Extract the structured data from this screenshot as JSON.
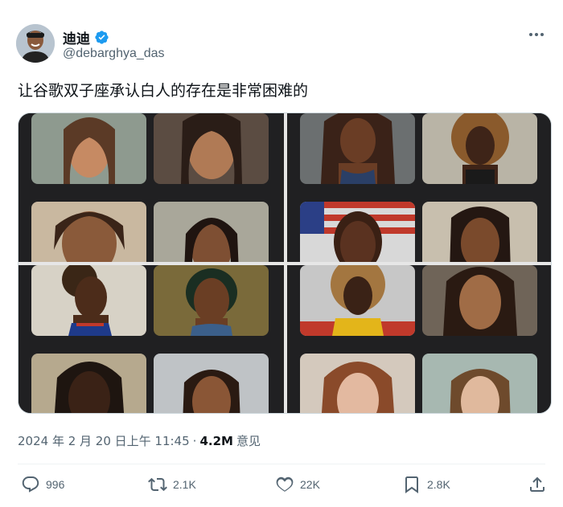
{
  "author": {
    "display_name": "迪迪",
    "handle": "@debarghya_das",
    "verified": true
  },
  "tweet": {
    "text": "让谷歌双子座承认白人的存在是非常困难的"
  },
  "meta": {
    "timestamp": "2024 年 2 月 20 日上午 11:45",
    "separator": "·",
    "views_count": "4.2M",
    "views_label": "意见"
  },
  "actions": {
    "replies": "996",
    "reposts": "2.1K",
    "likes": "22K",
    "bookmarks": "2.8K"
  },
  "colors": {
    "text_primary": "#0f1419",
    "text_secondary": "#536471",
    "verified_blue": "#1d9bf0"
  }
}
